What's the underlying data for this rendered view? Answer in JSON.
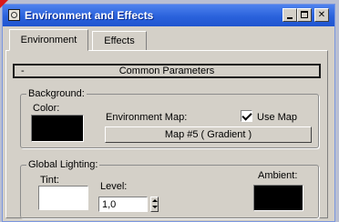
{
  "window": {
    "title": "Environment and Effects"
  },
  "tabs": [
    {
      "label": "Environment",
      "active": true
    },
    {
      "label": "Effects",
      "active": false
    }
  ],
  "rollout": {
    "toggle": "-",
    "title": "Common Parameters"
  },
  "background": {
    "legend": "Background:",
    "color_label": "Color:",
    "color_value": "#000000",
    "env_map_label": "Environment Map:",
    "use_map_label": "Use Map",
    "use_map_checked": true,
    "map_button": "Map #5  ( Gradient )"
  },
  "global_lighting": {
    "legend": "Global Lighting:",
    "tint_label": "Tint:",
    "tint_value": "#ffffff",
    "level_label": "Level:",
    "level_value": "1,0",
    "ambient_label": "Ambient:",
    "ambient_value": "#000000"
  }
}
